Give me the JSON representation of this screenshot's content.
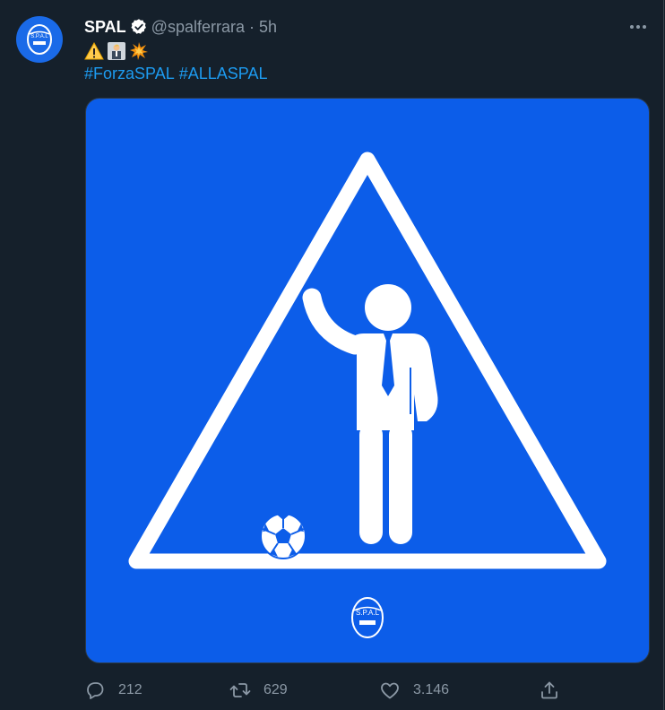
{
  "tweet": {
    "author_name": "SPAL",
    "author_handle": "@spalferrara",
    "separator": "·",
    "time": "5h",
    "emojis": [
      "warning-sign",
      "man-in-suit",
      "collision"
    ],
    "hashtags": [
      "#ForzaSPAL",
      "#ALLASPAL"
    ],
    "media_alt": "Road-sign style image: man in suit waving next to a football inside a warning triangle, SPAL logo below",
    "logo_text": "S.P.A.L"
  },
  "actions": {
    "reply_count": "212",
    "retweet_count": "629",
    "like_count": "3.146"
  },
  "colors": {
    "background": "#15202b",
    "link": "#1d9bf0",
    "muted": "#8b98a5",
    "media_bg": "#0c5de9",
    "verified": "#ffffff"
  }
}
